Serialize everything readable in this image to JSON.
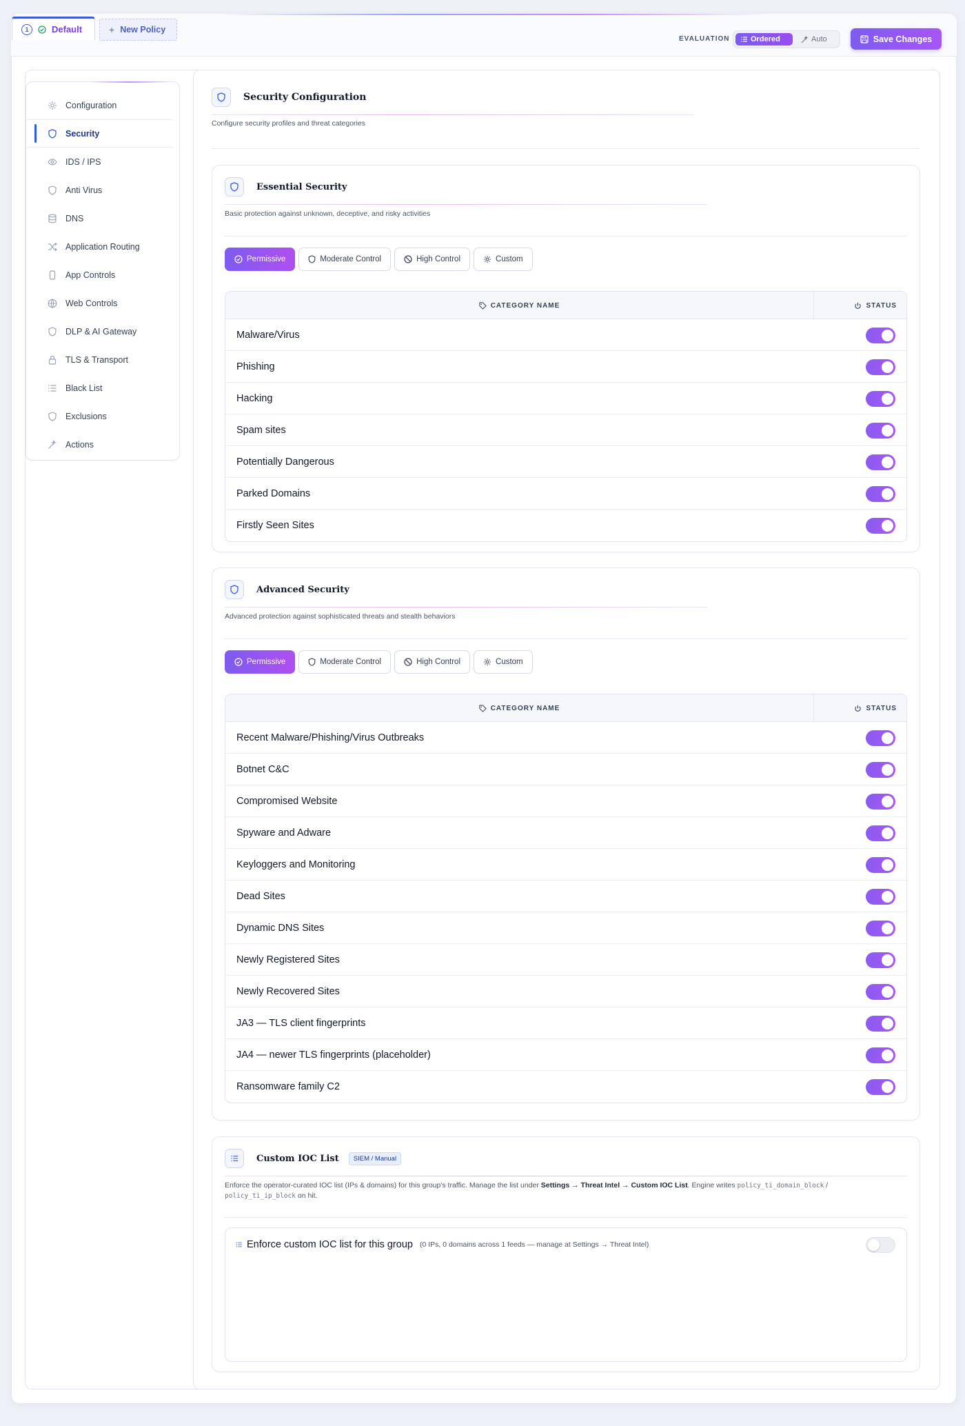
{
  "topbar": {
    "tabs": [
      {
        "number": "1",
        "label": "Default"
      }
    ],
    "new_policy_label": "New Policy",
    "evaluation_label": "EVALUATION",
    "evaluation_options": [
      {
        "label": "Ordered",
        "selected": true
      },
      {
        "label": "Auto",
        "selected": false
      }
    ],
    "save_label": "Save Changes"
  },
  "sidebar": {
    "items": [
      {
        "label": "Configuration",
        "icon": "gear-icon"
      },
      {
        "label": "Security",
        "icon": "shield-icon",
        "active": true
      },
      {
        "label": "IDS / IPS",
        "icon": "eye-icon"
      },
      {
        "label": "Anti Virus",
        "icon": "shield-icon"
      },
      {
        "label": "DNS",
        "icon": "database-icon"
      },
      {
        "label": "Application Routing",
        "icon": "shuffle-icon"
      },
      {
        "label": "App Controls",
        "icon": "phone-icon"
      },
      {
        "label": "Web Controls",
        "icon": "globe-icon"
      },
      {
        "label": "DLP & AI Gateway",
        "icon": "shield-icon"
      },
      {
        "label": "TLS & Transport",
        "icon": "lock-icon"
      },
      {
        "label": "Black List",
        "icon": "list-icon"
      },
      {
        "label": "Exclusions",
        "icon": "shield-icon"
      },
      {
        "label": "Actions",
        "icon": "wand-icon"
      }
    ]
  },
  "page": {
    "title": "Security Configuration",
    "description": "Configure security profiles and threat categories"
  },
  "presets": [
    "Permissive",
    "Moderate Control",
    "High Control",
    "Custom"
  ],
  "table_headers": {
    "category": "CATEGORY NAME",
    "status": "STATUS"
  },
  "essential": {
    "title": "Essential Security",
    "description": "Basic protection against unknown, deceptive, and risky activities",
    "rows": [
      "Malware/Virus",
      "Phishing",
      "Hacking",
      "Spam sites",
      "Potentially Dangerous",
      "Parked Domains",
      "Firstly Seen Sites"
    ]
  },
  "advanced": {
    "title": "Advanced Security",
    "description": "Advanced protection against sophisticated threats and stealth behaviors",
    "rows": [
      "Recent Malware/Phishing/Virus Outbreaks",
      "Botnet C&C",
      "Compromised Website",
      "Spyware and Adware",
      "Keyloggers and Monitoring",
      "Dead Sites",
      "Dynamic DNS Sites",
      "Newly Registered Sites",
      "Newly Recovered Sites",
      "JA3 — TLS client fingerprints",
      "JA4 — newer TLS fingerprints (placeholder)",
      "Ransomware family C2"
    ]
  },
  "ioc": {
    "title": "Custom IOC List",
    "badge": "SIEM / Manual",
    "desc_1": "Enforce the operator-curated IOC list (IPs & domains) for this group's traffic. Manage the list under ",
    "desc_settings": "Settings → Threat Intel → Custom IOC List",
    "desc_2": ". Engine writes ",
    "desc_code1": "policy_ti_domain_block",
    "desc_slash": " /",
    "desc_code2": "policy_ti_ip_block",
    "desc_3": " on hit.",
    "toggle_label": "Enforce custom IOC list for this group",
    "toggle_hint": "(0 IPs, 0 domains across 1 feeds — manage at Settings → Threat Intel)",
    "enabled": false
  },
  "colors": {
    "accent": "#7c5cf0",
    "accent2": "#a855f7",
    "brand_blue": "#3b5bdb"
  }
}
